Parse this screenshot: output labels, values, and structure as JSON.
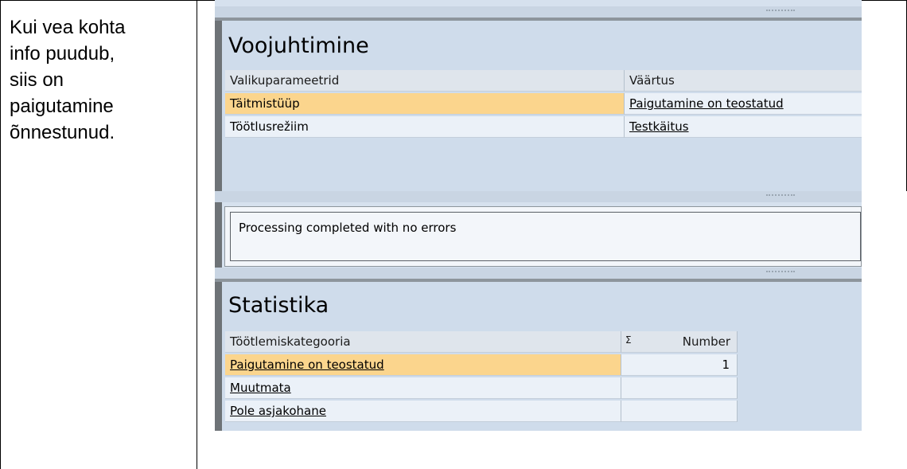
{
  "left_note": {
    "lines": [
      "Kui vea kohta",
      "info puudub,",
      "siis on",
      "paigutamine",
      "õnnestunud."
    ]
  },
  "flow_panel": {
    "title": "Voojuhtimine",
    "columns": [
      "Valikuparameetrid",
      "Väärtus"
    ],
    "rows": [
      {
        "param": "Täitmistüüp",
        "value": "Paigutamine on teostatud",
        "selected": true
      },
      {
        "param": "Töötlusrežiim",
        "value": "Testkäitus",
        "selected": false
      }
    ]
  },
  "message": {
    "text": "Processing completed with no errors"
  },
  "stats_panel": {
    "title": "Statistika",
    "columns": [
      "Töötlemiskategooria",
      "Σ",
      "Number"
    ],
    "rows": [
      {
        "category": "Paigutamine on teostatud",
        "number": "1",
        "selected": true
      },
      {
        "category": "Muutmata",
        "number": "",
        "selected": false
      },
      {
        "category": "Pole asjakohane",
        "number": "",
        "selected": false
      }
    ]
  },
  "colors": {
    "selected_row": "#fbd58d",
    "panel_bg": "#cfdceb",
    "cell_bg": "#ebf1f8"
  }
}
